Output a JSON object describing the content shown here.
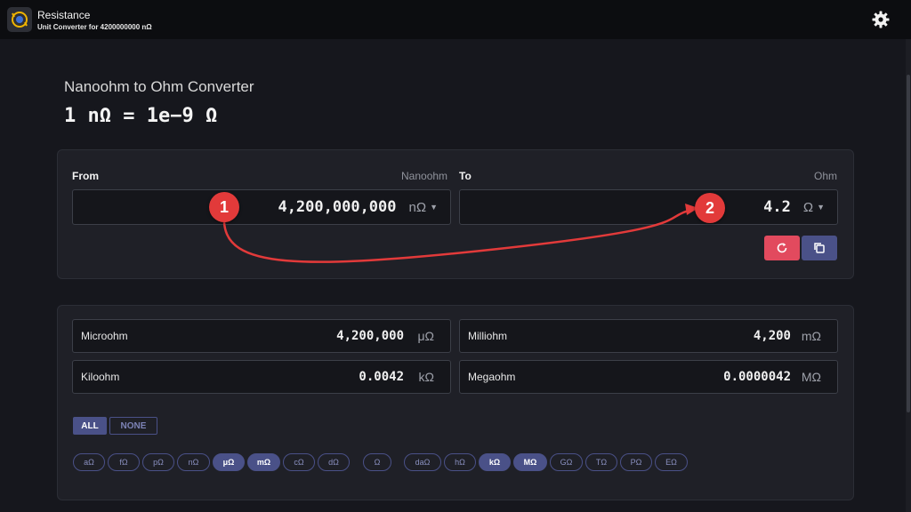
{
  "header": {
    "title": "Resistance",
    "subtitle": "Unit Converter for 4200000000 nΩ"
  },
  "page": {
    "title": "Nanoohm to Ohm Converter",
    "formula": "1 nΩ = 1e−9 Ω"
  },
  "converter": {
    "from_label": "From",
    "from_unit_name": "Nanoohm",
    "from_value": "4,200,000,000",
    "from_unit": "nΩ",
    "to_label": "To",
    "to_unit_name": "Ohm",
    "to_value": "4.2",
    "to_unit": "Ω"
  },
  "annotations": {
    "badge1": "1",
    "badge2": "2"
  },
  "results": [
    {
      "name": "Microohm",
      "value": "4,200,000",
      "unit": "μΩ"
    },
    {
      "name": "Milliohm",
      "value": "4,200",
      "unit": "mΩ"
    },
    {
      "name": "Kiloohm",
      "value": "0.0042",
      "unit": "kΩ"
    },
    {
      "name": "Megaohm",
      "value": "0.0000042",
      "unit": "MΩ"
    }
  ],
  "filters": {
    "all": "ALL",
    "none": "NONE"
  },
  "chips": [
    {
      "label": "aΩ",
      "on": false
    },
    {
      "label": "fΩ",
      "on": false
    },
    {
      "label": "pΩ",
      "on": false
    },
    {
      "label": "nΩ",
      "on": false
    },
    {
      "label": "μΩ",
      "on": true
    },
    {
      "label": "mΩ",
      "on": true
    },
    {
      "label": "cΩ",
      "on": false
    },
    {
      "label": "dΩ",
      "on": false
    },
    {
      "label": "Ω",
      "on": false
    },
    {
      "label": "daΩ",
      "on": false
    },
    {
      "label": "hΩ",
      "on": false
    },
    {
      "label": "kΩ",
      "on": true
    },
    {
      "label": "MΩ",
      "on": true
    },
    {
      "label": "GΩ",
      "on": false
    },
    {
      "label": "TΩ",
      "on": false
    },
    {
      "label": "PΩ",
      "on": false
    },
    {
      "label": "EΩ",
      "on": false
    }
  ],
  "colors": {
    "accent": "#4a5188",
    "danger": "#e24a5e",
    "annotation": "#e23a3a"
  }
}
